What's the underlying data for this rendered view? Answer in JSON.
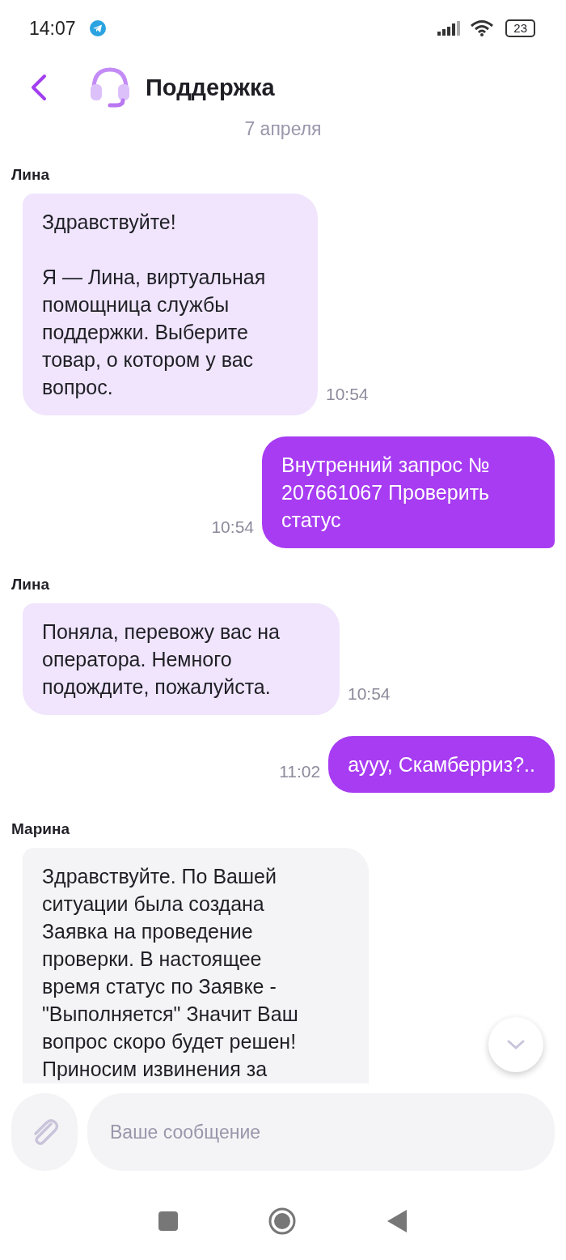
{
  "status_bar": {
    "time": "14:07",
    "battery": "23"
  },
  "header": {
    "title": "Поддержка"
  },
  "date": "7 апреля",
  "messages": [
    {
      "kind": "bot",
      "sender": "Лина",
      "text": "Здравствуйте!\n\nЯ — Лина, виртуальная помощница службы поддержки. Выберите товар, о котором у вас вопрос.",
      "time": "10:54"
    },
    {
      "kind": "outgoing",
      "text": "Внутренний запрос № 207661067 Проверить статус",
      "time": "10:54"
    },
    {
      "kind": "bot",
      "sender": "Лина",
      "text": "Поняла, перевожу вас на оператора. Немного подождите, пожалуйста.",
      "time": "10:54"
    },
    {
      "kind": "outgoing",
      "text": "аууу, Скамберриз?..",
      "time": "11:02"
    },
    {
      "kind": "operator",
      "sender": "Марина",
      "text": "Здравствуйте. По Вашей ситуации была создана Заявка на проведение проверки. В настоящее время статус по Заявке - \"Выполняется\" Значит Ваш вопрос скоро будет решен! Приносим извинения за"
    }
  ],
  "composer": {
    "placeholder": "Ваше сообщение"
  }
}
